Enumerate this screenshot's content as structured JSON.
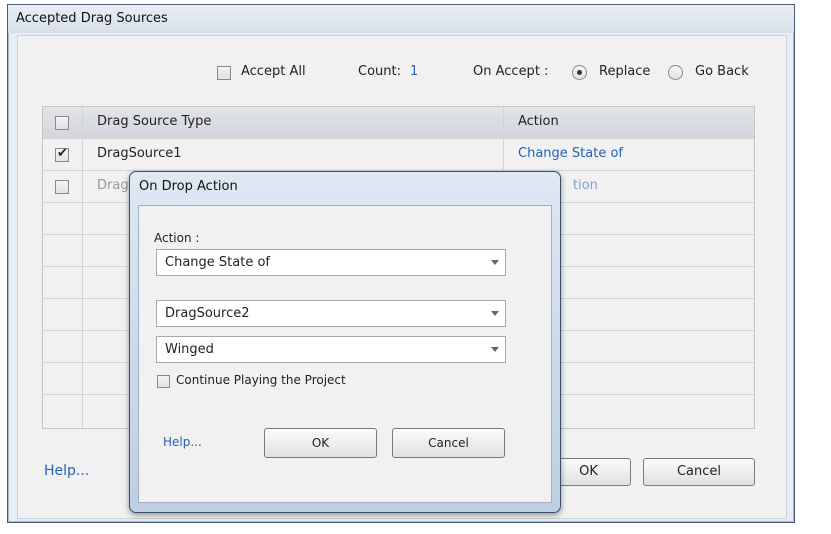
{
  "outer": {
    "title": "Accepted Drag Sources",
    "accept_all_label": "Accept All",
    "count_label": "Count:",
    "count_value": "1",
    "on_accept_label": "On Accept :",
    "replace_label": "Replace",
    "go_back_label": "Go Back",
    "table": {
      "col_type": "Drag Source Type",
      "col_action": "Action",
      "rows": [
        {
          "type": "DragSource1",
          "action": "Change State of",
          "checked": true
        },
        {
          "type": "Drag",
          "action": "tion",
          "checked": false
        }
      ]
    },
    "help_label": "Help...",
    "ok_label": "OK",
    "cancel_label": "Cancel"
  },
  "modal": {
    "title": "On Drop Action",
    "action_label": "Action :",
    "action_value": "Change State of",
    "source_value": "DragSource2",
    "state_value": "Winged",
    "continue_label": "Continue Playing the Project",
    "help_label": "Help...",
    "ok_label": "OK",
    "cancel_label": "Cancel"
  },
  "colors": {
    "link": "#2463b5"
  }
}
